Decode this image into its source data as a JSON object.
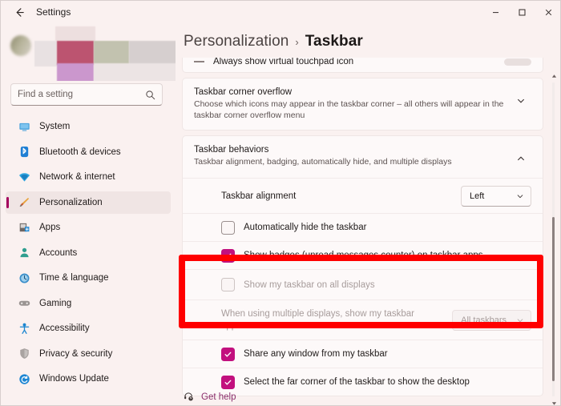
{
  "window": {
    "title": "Settings",
    "back_icon": "back-arrow-icon",
    "minimize_label": "Minimize",
    "maximize_label": "Maximize",
    "close_label": "Close"
  },
  "sidebar": {
    "search": {
      "placeholder": "Find a setting",
      "value": "",
      "icon": "search-icon"
    },
    "items": [
      {
        "label": "System",
        "icon": "monitor-icon",
        "selected": false
      },
      {
        "label": "Bluetooth & devices",
        "icon": "bluetooth-icon",
        "selected": false
      },
      {
        "label": "Network & internet",
        "icon": "wifi-icon",
        "selected": false
      },
      {
        "label": "Personalization",
        "icon": "paintbrush-icon",
        "selected": true
      },
      {
        "label": "Apps",
        "icon": "apps-icon",
        "selected": false
      },
      {
        "label": "Accounts",
        "icon": "person-icon",
        "selected": false
      },
      {
        "label": "Time & language",
        "icon": "clock-icon",
        "selected": false
      },
      {
        "label": "Gaming",
        "icon": "gamepad-icon",
        "selected": false
      },
      {
        "label": "Accessibility",
        "icon": "accessibility-icon",
        "selected": false
      },
      {
        "label": "Privacy & security",
        "icon": "shield-icon",
        "selected": false
      },
      {
        "label": "Windows Update",
        "icon": "update-icon",
        "selected": false
      }
    ]
  },
  "main": {
    "breadcrumb": {
      "parent": "Personalization",
      "separator": "›",
      "current": "Taskbar"
    },
    "partial_row": {
      "label": "Always show virtual touchpad icon"
    },
    "sections": [
      {
        "title": "Taskbar corner overflow",
        "subtitle": "Choose which icons may appear in the taskbar corner – all others will appear in the taskbar corner overflow menu",
        "expand_icon": "chevron-down-icon",
        "expanded": false
      },
      {
        "title": "Taskbar behaviors",
        "subtitle": "Taskbar alignment, badging, automatically hide, and multiple displays",
        "expand_icon": "chevron-up-icon",
        "expanded": true
      }
    ],
    "behaviors": {
      "alignment": {
        "label": "Taskbar alignment",
        "value": "Left",
        "chevron": "chevron-down-icon"
      },
      "checkboxes": [
        {
          "label": "Automatically hide the taskbar",
          "checked": false,
          "disabled": false,
          "highlighted": false
        },
        {
          "label": "Show badges (unread messages counter) on taskbar apps",
          "checked": true,
          "disabled": false,
          "highlighted": false
        },
        {
          "label": "Show my taskbar on all displays",
          "checked": false,
          "disabled": true,
          "highlighted": true
        }
      ],
      "multi_display": {
        "label": "When using multiple displays, show my taskbar apps on",
        "value": "All taskbars",
        "chevron": "chevron-down-icon",
        "disabled": true,
        "highlighted": true
      },
      "checkboxes_after": [
        {
          "label": "Share any window from my taskbar",
          "checked": true,
          "disabled": false
        },
        {
          "label": "Select the far corner of the taskbar to show the desktop",
          "checked": true,
          "disabled": false
        }
      ]
    },
    "footer": {
      "help_label": "Get help",
      "help_icon": "help-icon"
    },
    "scrollbar": {
      "up_icon": "scroll-up-arrow-icon",
      "down_icon": "scroll-down-arrow-icon"
    },
    "annotation": {
      "type": "highlight-rectangle",
      "color": "#ff0000"
    }
  },
  "colors": {
    "accent": "#c2107e",
    "selection_bar": "#a4005e",
    "annotation_red": "#ff0000",
    "link": "#8b2f6d",
    "background": "#faf1f0",
    "card": "#fdf9f9"
  }
}
